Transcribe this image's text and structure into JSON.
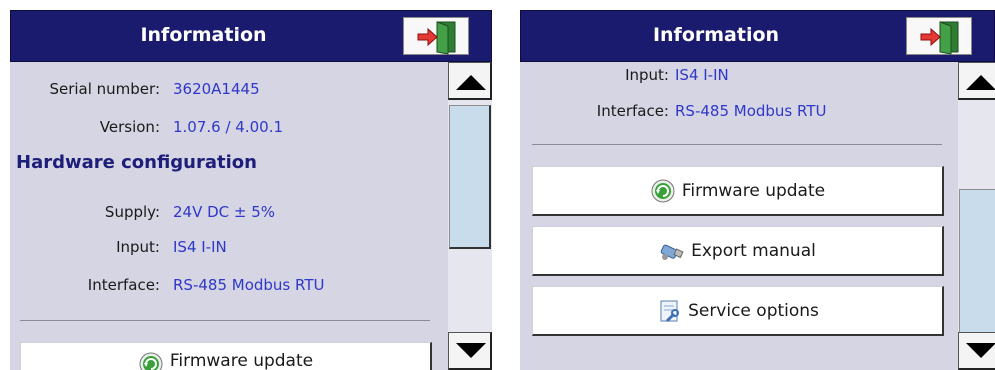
{
  "left": {
    "title": "Information",
    "rows": [
      {
        "label": "Serial number:",
        "value": "3620A1445"
      },
      {
        "label": "Version:",
        "value": "1.07.6 / 4.00.1"
      }
    ],
    "section_title": "Hardware configuration",
    "hw_rows": [
      {
        "label": "Supply:",
        "value": "24V DC ± 5%"
      },
      {
        "label": "Input:",
        "value": "IS4 I-IN"
      },
      {
        "label": "Interface:",
        "value": "RS-485 Modbus RTU"
      }
    ],
    "firmware_label": "Firmware update"
  },
  "right": {
    "title": "Information",
    "rows": [
      {
        "label": "Input:",
        "value": "IS4 I-IN"
      },
      {
        "label": "Interface:",
        "value": "RS-485 Modbus RTU"
      }
    ],
    "buttons": {
      "firmware": "Firmware update",
      "export": "Export manual",
      "service": "Service options"
    }
  },
  "icons": {
    "exit": "exit-door-icon",
    "firmware": "firmware-update-icon",
    "export": "usb-export-icon",
    "service": "service-options-icon",
    "scroll_up": "arrow-up-icon",
    "scroll_down": "arrow-down-icon"
  },
  "colors": {
    "title_bar": "#1a1a6e",
    "panel_bg": "#d5d5e3",
    "value_text": "#2f38c8",
    "section_title": "#1d1d7a",
    "scroll_thumb": "#c9dcec"
  }
}
